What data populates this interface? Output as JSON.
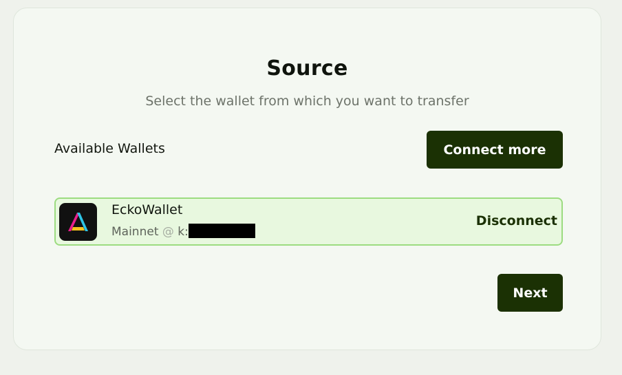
{
  "source": {
    "title": "Source",
    "subtitle": "Select the wallet from which you want to transfer"
  },
  "wallets": {
    "section_label": "Available Wallets",
    "connect_more_label": "Connect more",
    "items": [
      {
        "name": "EckoWallet",
        "network": "Mainnet",
        "at": "@",
        "address_prefix": "k:",
        "action_label": "Disconnect",
        "icon": "ecko-wallet-logo-icon"
      }
    ]
  },
  "footer": {
    "next_label": "Next"
  },
  "colors": {
    "background": "#eff2ec",
    "card": "#f4f8f2",
    "primary_dark": "#1b3104",
    "selected_row": "#e8f8df",
    "selected_border": "#9cdc80"
  }
}
